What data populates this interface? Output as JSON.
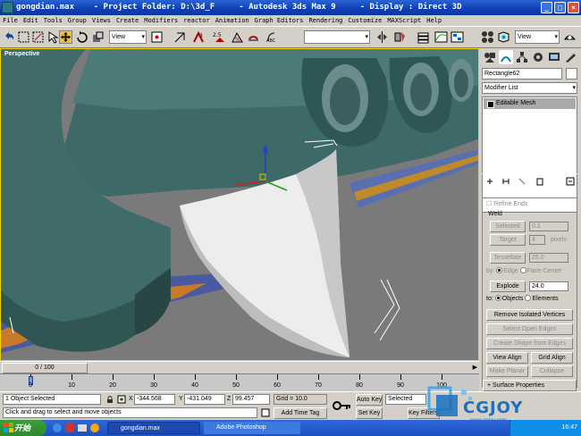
{
  "window": {
    "title": "gongdian.max    - Project Folder: D:\\3d_F     - Autodesk 3ds Max 9     - Display : Direct 3D"
  },
  "menu": [
    "File",
    "Edit",
    "Tools",
    "Group",
    "Views",
    "Create",
    "Modifiers",
    "reactor",
    "Animation",
    "Graph Editors",
    "Rendering",
    "Customize",
    "MAXScript",
    "Help"
  ],
  "toolbar": {
    "ref_coord_left": "View",
    "ref_coord_right": "View"
  },
  "viewport": {
    "label": "Perspective"
  },
  "command_panel": {
    "object_name": "Rectangle62",
    "modifier_list": "Modifier List",
    "stack_item": "Editable Mesh",
    "refine_ends": "Refine Ends",
    "weld_group": "Weld",
    "selected_btn": "Selected",
    "selected_val": "0.1",
    "target_btn": "Target",
    "target_val": "4",
    "target_unit": "pixels",
    "tessellate_btn": "Tessellate",
    "tessellate_val": "25.0",
    "by_label": "by:",
    "edge_label": "Edge",
    "face_center_label": "Face-Center",
    "explode_btn": "Explode",
    "explode_val": "24.0",
    "to_label": "to:",
    "objects_label": "Objects",
    "elements_label": "Elements",
    "remove_isolated": "Remove Isolated Vertices",
    "select_open_edges": "Select Open Edges",
    "create_shape": "Create Shape from Edges",
    "view_align": "View Align",
    "grid_align": "Grid Align",
    "make_planar": "Make Planar",
    "collapse": "Collapse",
    "surface_properties": "Surface Properties"
  },
  "timeline": {
    "frame_counter": "0 / 100",
    "ticks": [
      "0",
      "10",
      "20",
      "30",
      "40",
      "50",
      "60",
      "70",
      "80",
      "90",
      "100"
    ]
  },
  "status": {
    "selection": "1 Object Selected",
    "prompt": "Click and drag to select and move objects",
    "x_label": "X",
    "x_value": "-344.568",
    "y_label": "Y",
    "y_value": "-431.049",
    "z_label": "Z",
    "z_value": "99.457",
    "grid": "Grid = 10.0",
    "add_time_tag": "Add Time Tag",
    "auto_key": "Auto Key",
    "auto_key_mode": "Selected",
    "set_key": "Set Key",
    "key_filters": "Key Filters..."
  },
  "taskbar": {
    "start": "开始",
    "tasks": [
      "gongdian.max",
      "Adobe Photoshop"
    ],
    "clock": "16:47"
  },
  "watermark": {
    "brand": "CGJOY",
    "url": "www.cgjoy.com"
  },
  "colors": {
    "title_blue": "#0d3fb4",
    "object_teal": "#3f6b6b",
    "viewport_gray": "#7a7a7a",
    "active_viewport_border": "#f0d000"
  }
}
